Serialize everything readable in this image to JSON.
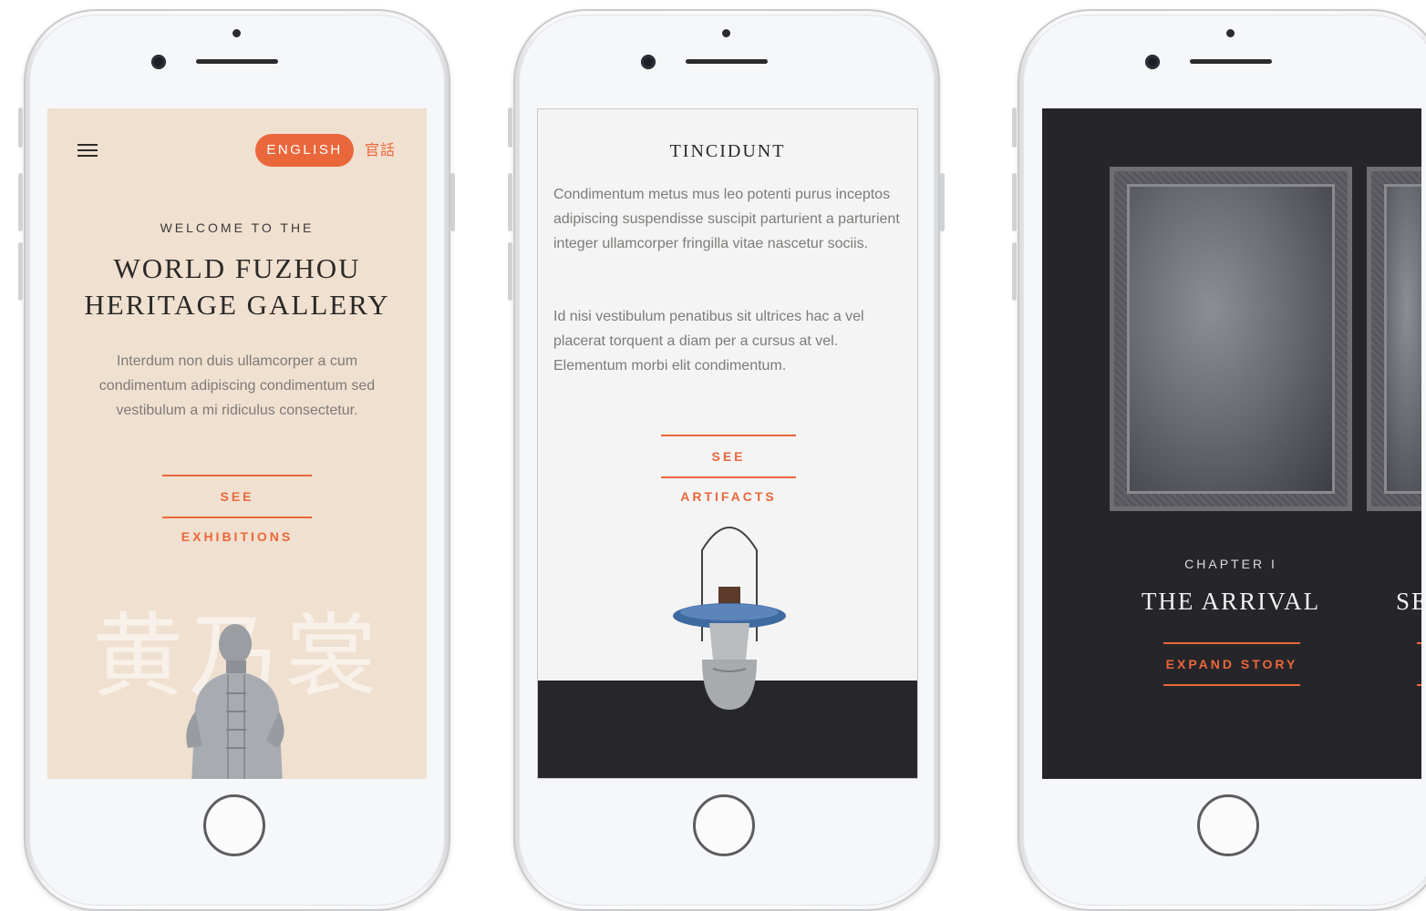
{
  "screen1": {
    "lang_active": "ENGLISH",
    "lang_alt": "官話",
    "eyebrow": "WELCOME TO THE",
    "title_line1": "WORLD FUZHOU",
    "title_line2": "HERITAGE GALLERY",
    "body": "Interdum non duis ullamcorper a cum condimentum adipiscing condimentum sed vestibulum a mi ridiculus consectetur.",
    "cta": "SEE EXHIBITIONS",
    "bg_chars": "黄乃裳"
  },
  "screen2": {
    "heading": "TINCIDUNT",
    "para1": "Condimentum metus mus leo potenti purus inceptos adipiscing suspendisse suscipit parturient a parturient integer ullamcorper fringilla vitae nascetur sociis.",
    "para2": "Id nisi vestibulum penatibus sit ultrices hac a vel placerat torquent a diam per a cursus at vel. Elementum morbi elit condimentum.",
    "cta": "SEE ARTIFACTS"
  },
  "screen3": {
    "chapter": "CHAPTER I",
    "title": "THE ARRIVAL",
    "next_title_partial": "SE",
    "cta": "EXPAND STORY"
  },
  "colors": {
    "accent": "#ea673c",
    "peach": "#f0e0d0",
    "dark": "#26262a",
    "light": "#f4f4f4"
  },
  "icons": {
    "menu": "hamburger-menu-icon",
    "home": "home-button-icon"
  }
}
